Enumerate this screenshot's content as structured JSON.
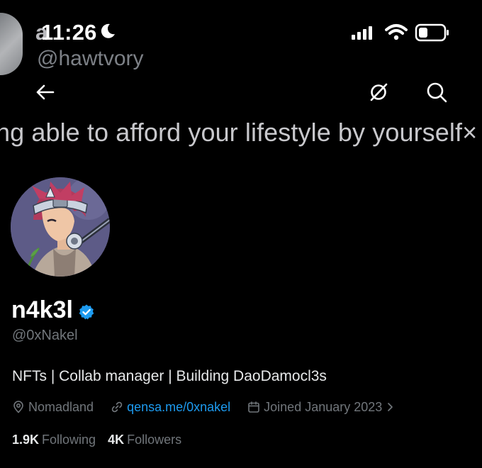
{
  "status_bar": {
    "time": "11:26",
    "ghost_name": "a",
    "ghost_handle": "@hawtvory"
  },
  "banner_text": "ng able to afford your lifestyle by yourself×",
  "profile": {
    "display_name": "n4k3l",
    "handle": "@0xNakel",
    "bio": "NFTs | Collab manager | Building DaoDamocl3s",
    "location": "Nomadland",
    "website": "qensa.me/0xnakel",
    "joined": "Joined January 2023",
    "following_count": "1.9K",
    "following_label": "Following",
    "followers_count": "4K",
    "followers_label": "Followers"
  },
  "icons": {
    "back": "arrow-left-icon",
    "grok": "grok-icon",
    "search": "search-icon",
    "location": "map-pin-icon",
    "link": "link-icon",
    "calendar": "calendar-icon",
    "verified": "verified-badge-icon"
  },
  "colors": {
    "background": "#000000",
    "accent": "#1d9bf0",
    "muted": "#71767b",
    "text": "#e7e9ea"
  }
}
